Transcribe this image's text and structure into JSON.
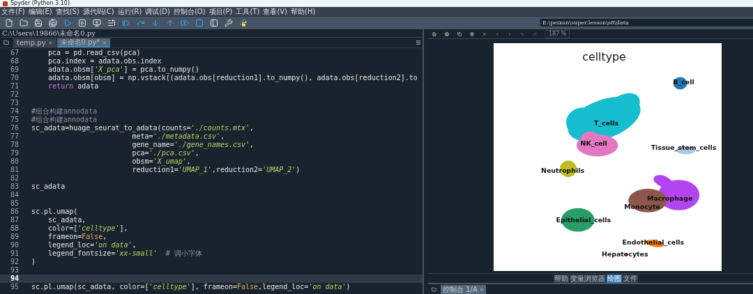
{
  "window": {
    "title": "Spyder (Python 3.10)"
  },
  "menu": [
    "文件(F)",
    "编辑(E)",
    "查找(S)",
    "源代码(C)",
    "运行(R)",
    "调试(D)",
    "控制台(O)",
    "项目(P)",
    "工具(T)",
    "查看(V)",
    "帮助(H)"
  ],
  "working_dir": "E:\\peixun\\super.lesson\\s8\\data",
  "editor": {
    "path": "C:\\Users\\19866\\未命名0.py",
    "tabs": [
      {
        "label": "temp.py",
        "selected": false
      },
      {
        "label": "未命名0.py*",
        "selected": true
      }
    ],
    "lines": [
      {
        "n": "67",
        "tokens": [
          {
            "kind": "plain",
            "text": "    pca = pd.read_csv(pca)"
          }
        ]
      },
      {
        "n": "68",
        "tokens": [
          {
            "kind": "plain",
            "text": "    pca.index = adata.obs.index"
          }
        ]
      },
      {
        "n": "69",
        "tokens": [
          {
            "kind": "plain",
            "text": "    adata.obsm["
          },
          {
            "kind": "string",
            "text": "'X_pca'"
          },
          {
            "kind": "plain",
            "text": "] = pca.to_numpy()"
          }
        ]
      },
      {
        "n": "70",
        "tokens": [
          {
            "kind": "plain",
            "text": "    adata.obsm[obsm] = np.vstack((adata.obs[reduction1].to_numpy(), adata.obs[reduction2].to"
          }
        ]
      },
      {
        "n": "71",
        "tokens": [
          {
            "kind": "keyword",
            "text": "    return"
          },
          {
            "kind": "plain",
            "text": " adata"
          }
        ]
      },
      {
        "n": "72"
      },
      {
        "n": "73"
      },
      {
        "n": "74",
        "tokens": [
          {
            "kind": "comment",
            "text": "#组合构建annodata"
          }
        ]
      },
      {
        "n": "75",
        "tokens": [
          {
            "kind": "comment",
            "text": "#组合构建annodata"
          }
        ]
      },
      {
        "n": "76",
        "tokens": [
          {
            "kind": "plain",
            "text": "sc_adata=huage_seurat_to_adata(counts="
          },
          {
            "kind": "string",
            "text": "'./counts.mtx'"
          },
          {
            "kind": "plain",
            "text": ","
          }
        ]
      },
      {
        "n": "77",
        "tokens": [
          {
            "kind": "plain",
            "text": "                        meta="
          },
          {
            "kind": "string",
            "text": "'./metadata.csv'"
          },
          {
            "kind": "plain",
            "text": ","
          }
        ]
      },
      {
        "n": "78",
        "tokens": [
          {
            "kind": "plain",
            "text": "                        gene_name="
          },
          {
            "kind": "string",
            "text": "'./gene_names.csv'"
          },
          {
            "kind": "plain",
            "text": ","
          }
        ]
      },
      {
        "n": "79",
        "tokens": [
          {
            "kind": "plain",
            "text": "                        pca="
          },
          {
            "kind": "string",
            "text": "'./pca.csv'"
          },
          {
            "kind": "plain",
            "text": ","
          }
        ]
      },
      {
        "n": "80",
        "tokens": [
          {
            "kind": "plain",
            "text": "                        obsm="
          },
          {
            "kind": "string",
            "text": "'X_umap'"
          },
          {
            "kind": "plain",
            "text": ","
          }
        ]
      },
      {
        "n": "81",
        "tokens": [
          {
            "kind": "plain",
            "text": "                        reduction1="
          },
          {
            "kind": "string",
            "text": "'UMAP_1'"
          },
          {
            "kind": "plain",
            "text": ",reduction2="
          },
          {
            "kind": "string",
            "text": "'UMAP_2'"
          },
          {
            "kind": "plain",
            "text": ")"
          }
        ]
      },
      {
        "n": "82"
      },
      {
        "n": "83",
        "tokens": [
          {
            "kind": "plain",
            "text": "sc_adata"
          }
        ]
      },
      {
        "n": "84"
      },
      {
        "n": "85"
      },
      {
        "n": "86",
        "tokens": [
          {
            "kind": "plain",
            "text": "sc.pl.umap("
          }
        ]
      },
      {
        "n": "87",
        "tokens": [
          {
            "kind": "plain",
            "text": "    sc_adata,"
          }
        ]
      },
      {
        "n": "88",
        "tokens": [
          {
            "kind": "plain",
            "text": "    color=["
          },
          {
            "kind": "string",
            "text": "'celltype'"
          },
          {
            "kind": "plain",
            "text": "],"
          }
        ]
      },
      {
        "n": "89",
        "tokens": [
          {
            "kind": "plain",
            "text": "    frameon="
          },
          {
            "kind": "bool",
            "text": "False"
          },
          {
            "kind": "plain",
            "text": ","
          }
        ]
      },
      {
        "n": "90",
        "tokens": [
          {
            "kind": "plain",
            "text": "    legend_loc="
          },
          {
            "kind": "string",
            "text": "'on data'"
          },
          {
            "kind": "plain",
            "text": ","
          }
        ]
      },
      {
        "n": "91",
        "tokens": [
          {
            "kind": "plain",
            "text": "    legend_fontsize="
          },
          {
            "kind": "string",
            "text": "'xx-small'"
          },
          {
            "kind": "comment",
            "text": "  # 调小字体"
          }
        ]
      },
      {
        "n": "92",
        "tokens": [
          {
            "kind": "plain",
            "text": ")"
          }
        ]
      },
      {
        "n": "93"
      },
      {
        "n": "94",
        "current": true
      },
      {
        "n": "95",
        "tokens": [
          {
            "kind": "plain",
            "text": "sc.pl.umap(sc_adata, color=["
          },
          {
            "kind": "string",
            "text": "'celltype'"
          },
          {
            "kind": "plain",
            "text": "], frameon="
          },
          {
            "kind": "bool",
            "text": "False"
          },
          {
            "kind": "plain",
            "text": ",legend_loc="
          },
          {
            "kind": "string",
            "text": "'on data'"
          },
          {
            "kind": "plain",
            "text": ")"
          }
        ]
      }
    ]
  },
  "plots": {
    "zoom": "187 %",
    "figure": {
      "title": "celltype",
      "clusters": [
        {
          "label": "B_cell",
          "color": "#1f77b4"
        },
        {
          "label": "T_cells",
          "color": "#17becf"
        },
        {
          "label": "NK_cell",
          "color": "#e377c2"
        },
        {
          "label": "Tissue_stem_cells",
          "color": "#aec7e8"
        },
        {
          "label": "Neutrophils",
          "color": "#bcbd22"
        },
        {
          "label": "Macrophage",
          "color": "#b245f0"
        },
        {
          "label": "Monocyte",
          "color": "#8c564b"
        },
        {
          "label": "Epithelial_cells",
          "color": "#279e68"
        },
        {
          "label": "Endothelial_cells",
          "color": "#ff7f0e"
        },
        {
          "label": "Hepatocytes",
          "color": "#d62728"
        }
      ]
    }
  },
  "pane_tabs": [
    {
      "label": "帮助",
      "selected": false
    },
    {
      "label": "变量浏览器",
      "selected": false
    },
    {
      "label": "绘图",
      "selected": true
    },
    {
      "label": "文件",
      "selected": false
    }
  ],
  "console_tabs": [
    {
      "label": "控制台 1/A"
    }
  ]
}
